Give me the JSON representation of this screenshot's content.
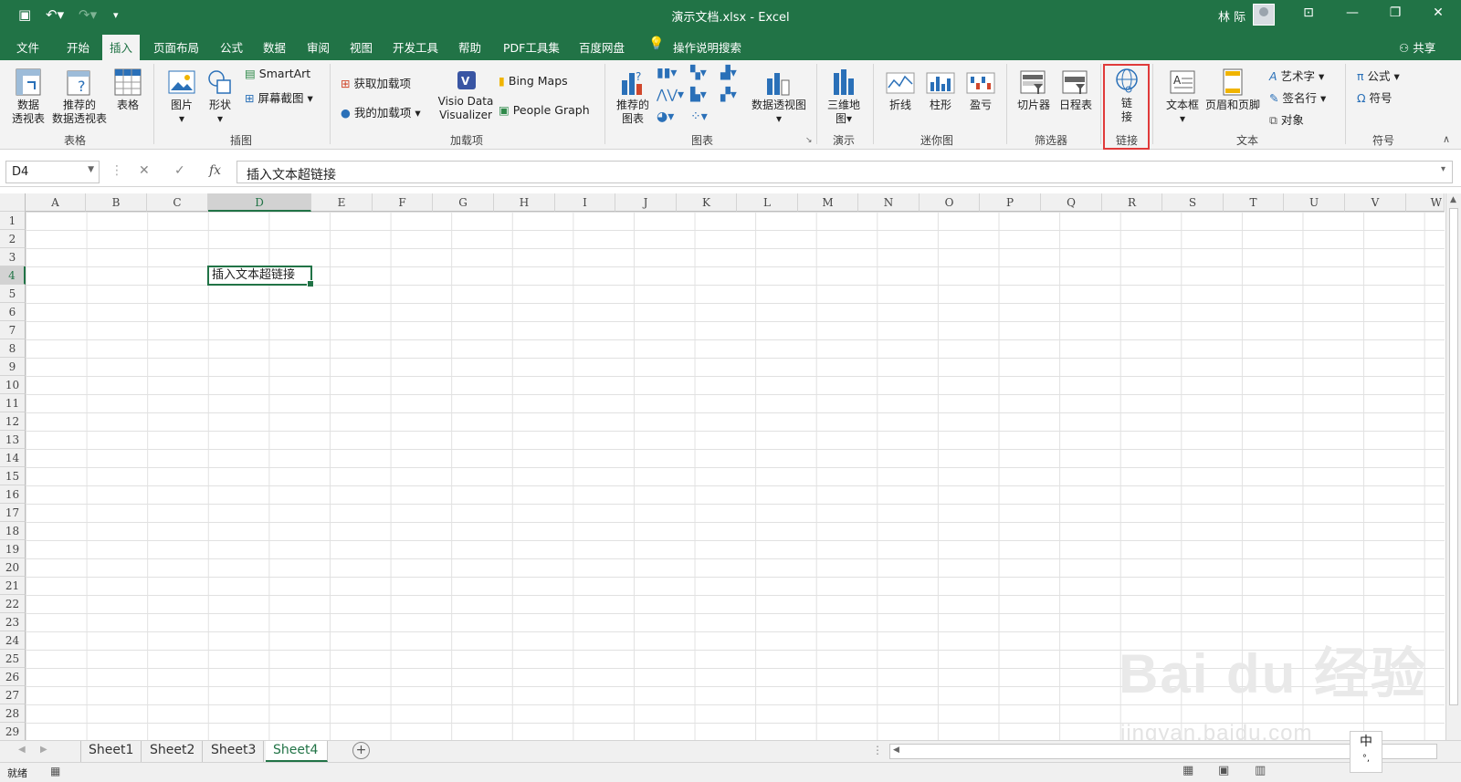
{
  "window": {
    "title": "演示文档.xlsx - Excel",
    "user": "林 际"
  },
  "tabs": [
    "文件",
    "开始",
    "插入",
    "页面布局",
    "公式",
    "数据",
    "审阅",
    "视图",
    "开发工具",
    "帮助",
    "PDF工具集",
    "百度网盘",
    "操作说明搜索"
  ],
  "share": "共享",
  "ribbon": {
    "pivot": "数据\n透视表",
    "recommended_pivot": "推荐的\n数据透视表",
    "table": "表格",
    "group_table": "表格",
    "picture": "图片",
    "shapes": "形状",
    "smartart": "SmartArt",
    "screenshot": "屏幕截图",
    "group_illustrations": "插图",
    "get_addins": "获取加载项",
    "my_addins": "我的加载项",
    "visio": "Visio Data\nVisualizer",
    "bing_maps": "Bing Maps",
    "people_graph": "People Graph",
    "group_addins": "加载项",
    "recommended_charts": "推荐的\n图表",
    "pivot_chart": "数据透视图",
    "group_charts": "图表",
    "map3d": "三维地\n图",
    "group_tours": "演示",
    "line": "折线",
    "column": "柱形",
    "winloss": "盈亏",
    "group_sparklines": "迷你图",
    "slicer": "切片器",
    "timeline": "日程表",
    "group_filters": "筛选器",
    "link": "链\n接",
    "group_links": "链接",
    "textbox": "文本框",
    "header_footer": "页眉和页脚",
    "wordart": "艺术字",
    "signature": "签名行",
    "object": "对象",
    "group_text": "文本",
    "equation": "公式",
    "symbol": "符号",
    "group_symbols": "符号"
  },
  "formula_bar": {
    "name_box": "D4",
    "content": "插入文本超链接"
  },
  "columns": [
    "A",
    "B",
    "C",
    "D",
    "E",
    "F",
    "G",
    "H",
    "I",
    "J",
    "K",
    "L",
    "M",
    "N",
    "O",
    "P",
    "Q",
    "R",
    "S",
    "T",
    "U",
    "V",
    "W"
  ],
  "rows": [
    "1",
    "2",
    "3",
    "4",
    "5",
    "6",
    "7",
    "8",
    "9",
    "10",
    "11",
    "12",
    "13",
    "14",
    "15",
    "16",
    "17",
    "18",
    "19",
    "20",
    "21",
    "22",
    "23",
    "24",
    "25",
    "26",
    "27",
    "28",
    "29"
  ],
  "active_cell": {
    "ref": "D4",
    "value": "插入文本超链接"
  },
  "sheets": [
    "Sheet1",
    "Sheet2",
    "Sheet3",
    "Sheet4"
  ],
  "active_sheet": "Sheet4",
  "status": "就绪",
  "watermark": {
    "main": "Bai du 经验",
    "sub": "jingyan.baidu.com"
  },
  "ime": "中",
  "colors": {
    "accent": "#217346",
    "highlight": "#e03a3a"
  }
}
